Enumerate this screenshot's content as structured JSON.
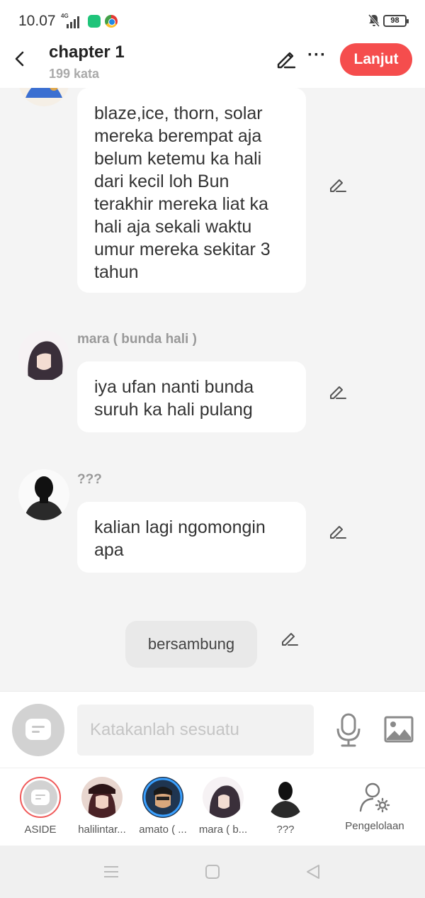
{
  "status_bar": {
    "time": "10.07",
    "network": "4G",
    "battery": "98"
  },
  "header": {
    "title": "chapter 1",
    "subtitle": "199 kata",
    "next_label": "Lanjut"
  },
  "messages": [
    {
      "speaker": "",
      "text": "blaze,ice, thorn, solar mereka berempat aja belum ketemu ka hali dari kecil loh Bun terakhir mereka liat ka hali aja sekali waktu umur mereka sekitar 3 tahun"
    },
    {
      "speaker": "mara ( bunda hali )",
      "text": "iya ufan nanti bunda suruh ka hali pulang"
    },
    {
      "speaker": "???",
      "text": "kalian lagi ngomongin apa"
    }
  ],
  "end_label": "bersambung",
  "input": {
    "placeholder": "Katakanlah sesuatu"
  },
  "characters": [
    {
      "name": "ASIDE"
    },
    {
      "name": "halilintar..."
    },
    {
      "name": "amato ( ..."
    },
    {
      "name": "mara ( b..."
    },
    {
      "name": "???"
    },
    {
      "name": "Pengelolaan"
    }
  ],
  "colors": {
    "accent": "#f54d4d",
    "background": "#f4f4f4"
  },
  "icons": [
    "back-arrow-icon",
    "pencil-icon",
    "more-icon",
    "microphone-icon",
    "image-icon",
    "user-settings-icon"
  ]
}
